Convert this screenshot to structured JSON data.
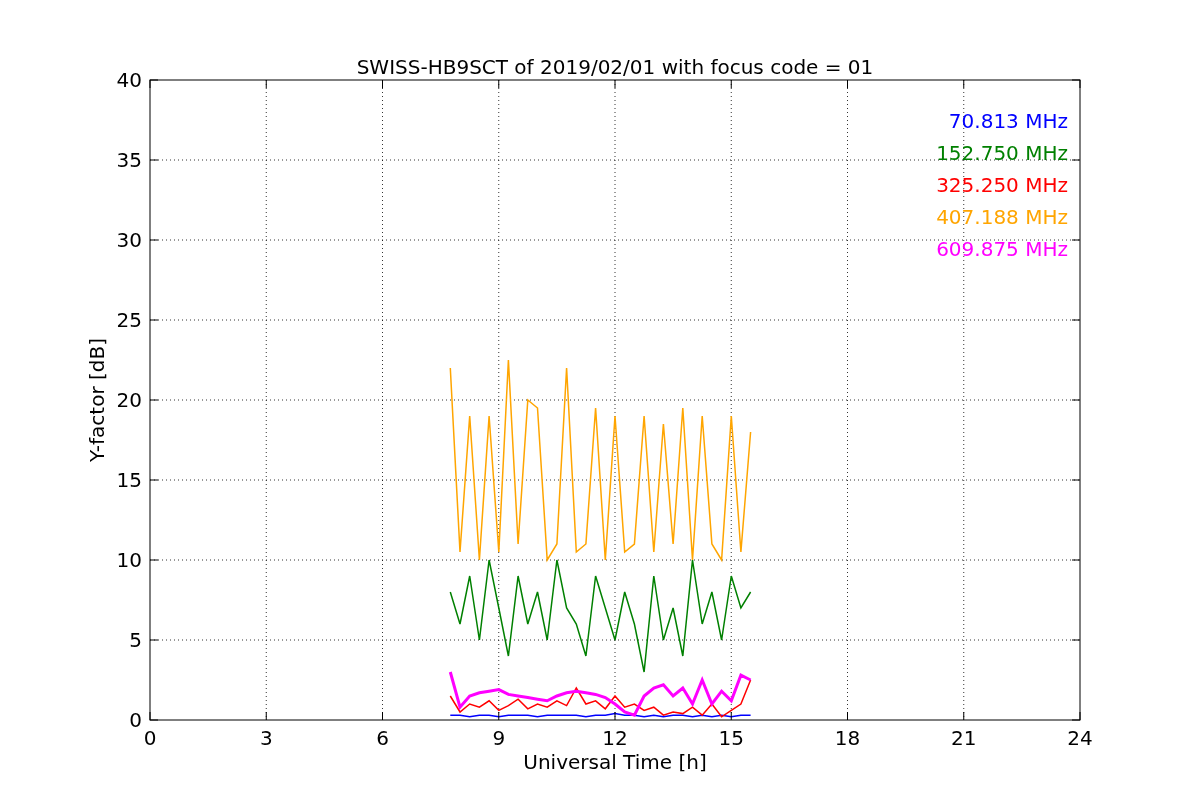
{
  "figure": {
    "chart_data": {
      "type": "line",
      "title": "SWISS-HB9SCT of 2019/02/01 with focus code = 01",
      "xlabel": "Universal Time [h]",
      "ylabel": "Y-factor [dB]",
      "x": [
        7.75,
        8,
        8.25,
        8.5,
        8.75,
        9,
        9.25,
        9.5,
        9.75,
        10,
        10.25,
        10.5,
        10.75,
        11,
        11.25,
        11.5,
        11.75,
        12,
        12.25,
        12.5,
        12.75,
        13,
        13.25,
        13.5,
        13.75,
        14,
        14.25,
        14.5,
        14.75,
        15,
        15.25,
        15.5
      ],
      "series": [
        {
          "name": "70.813 MHz",
          "color": "#0000ff",
          "values": [
            0.3,
            0.3,
            0.2,
            0.3,
            0.3,
            0.2,
            0.3,
            0.3,
            0.3,
            0.2,
            0.3,
            0.3,
            0.3,
            0.3,
            0.2,
            0.3,
            0.3,
            0.4,
            0.3,
            0.3,
            0.2,
            0.3,
            0.2,
            0.3,
            0.3,
            0.2,
            0.3,
            0.2,
            0.3,
            0.2,
            0.3,
            0.3
          ]
        },
        {
          "name": "152.750 MHz",
          "color": "#008000",
          "values": [
            8,
            6,
            9,
            5,
            10,
            7,
            4,
            9,
            6,
            8,
            5,
            10,
            7,
            6,
            4,
            9,
            7,
            5,
            8,
            6,
            3,
            9,
            5,
            7,
            4,
            10,
            6,
            8,
            5,
            9,
            7,
            8
          ]
        },
        {
          "name": "325.250 MHz",
          "color": "#ff0000",
          "values": [
            1.5,
            0.5,
            1.0,
            0.8,
            1.2,
            0.6,
            0.9,
            1.3,
            0.7,
            1.0,
            0.8,
            1.2,
            0.9,
            2.0,
            1.0,
            1.2,
            0.7,
            1.5,
            0.8,
            1.0,
            0.6,
            0.8,
            0.3,
            0.5,
            0.4,
            0.8,
            0.3,
            1.0,
            0.2,
            0.6,
            1.0,
            2.5
          ]
        },
        {
          "name": "407.188 MHz",
          "color": "#ffa500",
          "values": [
            22,
            10.5,
            19,
            10,
            19,
            10.5,
            22.5,
            11,
            20,
            19.5,
            10,
            11,
            22,
            10.5,
            11,
            19.5,
            10,
            19,
            10.5,
            11,
            19,
            10.5,
            18.5,
            11,
            19.5,
            10,
            19,
            11,
            10,
            19,
            10.5,
            18
          ]
        },
        {
          "name": "609.875 MHz",
          "color": "#ff00ff",
          "values": [
            3,
            0.8,
            1.5,
            1.7,
            1.8,
            1.9,
            1.6,
            1.5,
            1.4,
            1.3,
            1.2,
            1.5,
            1.7,
            1.8,
            1.7,
            1.6,
            1.4,
            1.0,
            0.5,
            0.3,
            1.5,
            2.0,
            2.2,
            1.5,
            2.0,
            1.0,
            2.5,
            1.0,
            1.8,
            1.2,
            2.8,
            2.5
          ]
        }
      ],
      "xlim": [
        0,
        24
      ],
      "ylim": [
        0,
        40
      ],
      "xticks": [
        0,
        3,
        6,
        9,
        12,
        15,
        18,
        21,
        24
      ],
      "yticks": [
        0,
        5,
        10,
        15,
        20,
        25,
        30,
        35,
        40
      ],
      "grid": true
    }
  }
}
